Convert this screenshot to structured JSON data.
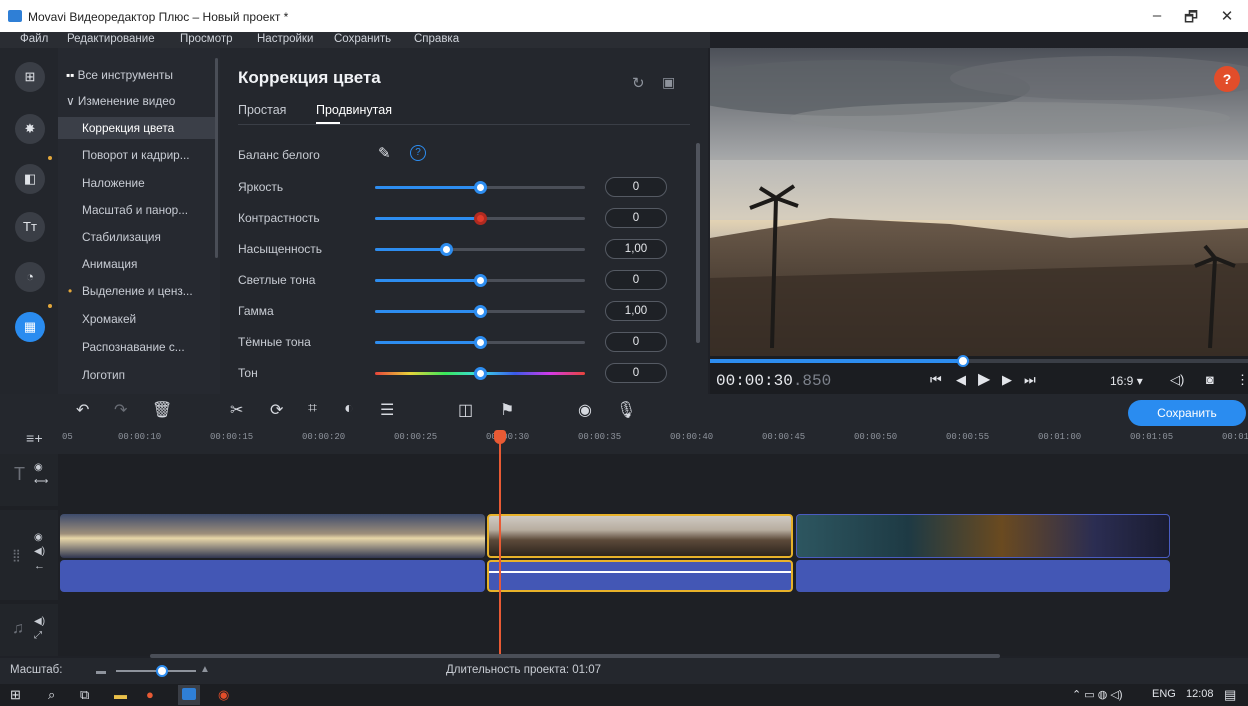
{
  "window": {
    "title": "Movavi Видеоредактор Плюс – Новый проект *",
    "controls": {
      "minimize": "–",
      "maximize": "🗗",
      "close": "✕"
    }
  },
  "menu": [
    "Файл",
    "Редактирование",
    "Просмотр",
    "Настройки",
    "Сохранить",
    "Справка"
  ],
  "tools": {
    "all_tools": "Все инструменты",
    "group": "Изменение видео",
    "items": [
      "Коррекция цвета",
      "Поворот и кадрир...",
      "Наложение",
      "Масштаб и панор...",
      "Стабилизация",
      "Анимация",
      "Выделение и ценз...",
      "Хромакей",
      "Распознавание с...",
      "Логотип"
    ],
    "selected": "Коррекция цвета"
  },
  "panel": {
    "title": "Коррекция цвета",
    "tabs": [
      "Простая",
      "Продвинутая"
    ],
    "active_tab": "Продвинутая",
    "white_balance": "Баланс белого",
    "sliders": [
      {
        "label": "Яркость",
        "value": "0",
        "level": 0.5
      },
      {
        "label": "Контрастность",
        "value": "0",
        "level": 0.5
      },
      {
        "label": "Насыщенность",
        "value": "1,00",
        "level": 0.34
      },
      {
        "label": "Светлые тона",
        "value": "0",
        "level": 0.5
      },
      {
        "label": "Гамма",
        "value": "1,00",
        "level": 0.5
      },
      {
        "label": "Тёмные тона",
        "value": "0",
        "level": 0.5
      },
      {
        "label": "Тон",
        "value": "0",
        "level": 0.5
      }
    ]
  },
  "player": {
    "timecode": "00:00:30",
    "timecode_ms": ".850",
    "progress": 0.47,
    "aspect": "16:9 ▾",
    "help": "?"
  },
  "timeline": {
    "save_label": "Сохранить",
    "ruler": [
      "05",
      "00:00:10",
      "00:00:15",
      "00:00:20",
      "00:00:25",
      "00:00:30",
      "00:00:35",
      "00:00:40",
      "00:00:45",
      "00:00:50",
      "00:00:55",
      "00:01:00",
      "00:01:05",
      "00:01"
    ]
  },
  "bottom": {
    "scale_label": "Масштаб:",
    "duration": "Длительность проекта: 01:07"
  },
  "taskbar": {
    "lang": "ENG",
    "time": "12:08"
  },
  "colors": {
    "accent": "#2a8cf0",
    "selected_clip_border": "#e8b22a",
    "playhead": "#e85a34"
  }
}
